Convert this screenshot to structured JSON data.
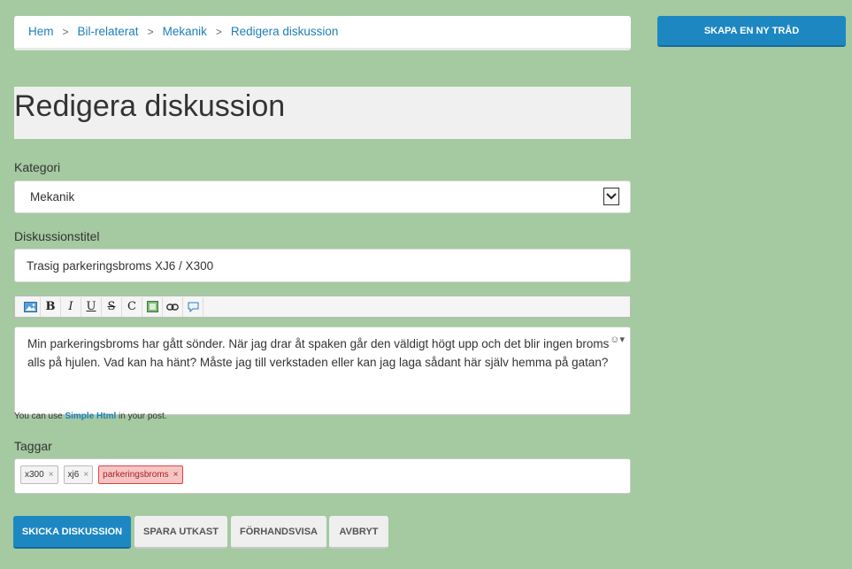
{
  "breadcrumb": {
    "items": [
      "Hem",
      "Bil-relaterat",
      "Mekanik",
      "Redigera diskussion"
    ],
    "separator": ">"
  },
  "sidebar": {
    "new_thread_label": "SKAPA EN NY TRÅD"
  },
  "page": {
    "title": "Redigera diskussion"
  },
  "form": {
    "category_label": "Kategori",
    "category_value": "Mekanik",
    "title_label": "Diskussionstitel",
    "title_value": "Trasig parkeringsbroms XJ6 / X300",
    "body_text": "Min parkeringsbroms har gått sönder. När jag drar åt spaken går den väldigt högt upp och det blir ingen broms alls på hjulen. Vad kan ha hänt? Måste jag till verkstaden eller kan jag laga sådant här själv hemma på gatan?",
    "hint_prefix": "You can use",
    "hint_link": "Simple Html",
    "hint_suffix": "in your post.",
    "tags_label": "Taggar",
    "tags": [
      {
        "text": "x300",
        "invalid": false
      },
      {
        "text": "xj6",
        "invalid": false
      },
      {
        "text": "parkeringsbroms",
        "invalid": true
      }
    ],
    "tag_remove": "×"
  },
  "toolbar": {
    "bold": "B",
    "italic": "I",
    "underline": "U",
    "strike": "S",
    "code": "C",
    "icons": [
      "image-icon",
      "bold-icon",
      "italic-icon",
      "underline-icon",
      "strikethrough-icon",
      "code-icon",
      "picture-icon",
      "link-icon",
      "quote-icon"
    ]
  },
  "actions": {
    "submit": "SKICKA DISKUSSION",
    "save_draft": "SPARA UTKAST",
    "preview": "FÖRHANDSVISA",
    "cancel": "AVBRYT"
  },
  "colors": {
    "background": "#a5c9a1",
    "primary": "#1d87c2",
    "link": "#1e7fb8",
    "invalid_tag": "#f7c4c4"
  }
}
